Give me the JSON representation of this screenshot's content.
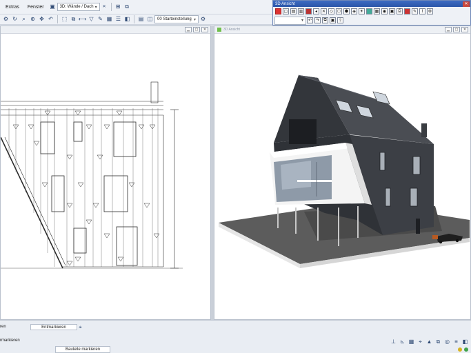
{
  "menubar": {
    "items": [
      "Extras",
      "Fenster"
    ],
    "view_combo": "3D: Wände / Dach"
  },
  "toolbar2": {
    "layer_combo": "00 Starteinstellung"
  },
  "panel3d": {
    "title": "3D Ansicht"
  },
  "viewport_right": {
    "label": "3D Ansicht"
  },
  "bottom": {
    "left_label_1": "ren",
    "unmark_button": "Entmarkieren",
    "left_label_2": "rmarkieren",
    "mark_button": "Bauteile markieren"
  },
  "colors": {
    "accent": "#2a55a8",
    "roof": "#3e4147",
    "wall_white": "#f2f2f2",
    "ground": "#5a5a5a"
  }
}
